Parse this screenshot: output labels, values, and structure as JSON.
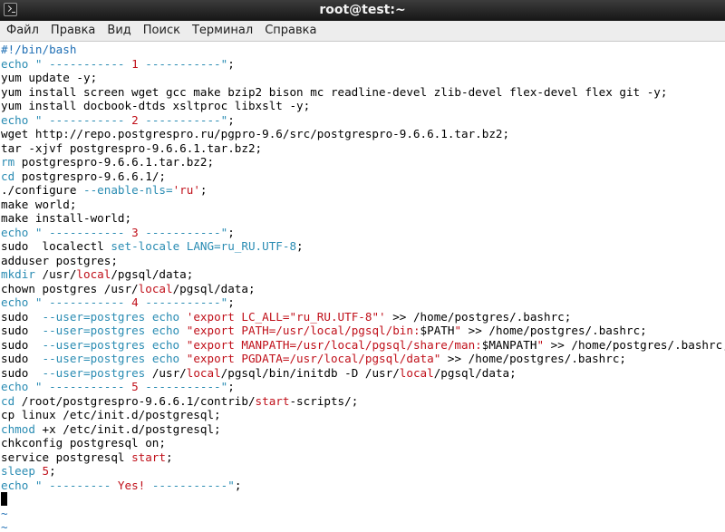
{
  "window": {
    "title": "root@test:~"
  },
  "menu": [
    {
      "label": "Файл"
    },
    {
      "label": "Правка"
    },
    {
      "label": "Вид"
    },
    {
      "label": "Поиск"
    },
    {
      "label": "Терминал"
    },
    {
      "label": "Справка"
    }
  ],
  "terminal": {
    "lines": [
      [
        {
          "t": "#!/bin/bash",
          "c": "t"
        }
      ],
      [
        {
          "t": "echo \" ----------- ",
          "c": "b"
        },
        {
          "t": "1",
          "c": "r"
        },
        {
          "t": " -----------\"",
          "c": "b"
        },
        {
          "t": ";",
          "c": ""
        }
      ],
      [
        {
          "t": "yum update -y;",
          "c": ""
        }
      ],
      [
        {
          "t": "yum install screen wget gcc make bzip2 bison mc readline-devel zlib-devel flex-devel flex git -y;",
          "c": ""
        }
      ],
      [
        {
          "t": "yum install docbook-dtds xsltproc libxslt -y;",
          "c": ""
        }
      ],
      [
        {
          "t": "echo \" ----------- ",
          "c": "b"
        },
        {
          "t": "2",
          "c": "r"
        },
        {
          "t": " -----------\"",
          "c": "b"
        },
        {
          "t": ";",
          "c": ""
        }
      ],
      [
        {
          "t": "wget http://repo.postgrespro.ru/pgpro-9.6/src/postgrespro-9.6.6.1.tar.bz2;",
          "c": ""
        }
      ],
      [
        {
          "t": "tar -xjvf postgrespro-9.6.6.1.tar.bz2;",
          "c": ""
        }
      ],
      [
        {
          "t": "rm",
          "c": "b"
        },
        {
          "t": " postgrespro-9.6.6.1.tar.bz2;",
          "c": ""
        }
      ],
      [
        {
          "t": "cd",
          "c": "b"
        },
        {
          "t": " postgrespro-9.6.6.1/;",
          "c": ""
        }
      ],
      [
        {
          "t": "./configure ",
          "c": ""
        },
        {
          "t": "--enable-nls=",
          "c": "b"
        },
        {
          "t": "'ru'",
          "c": "r"
        },
        {
          "t": ";",
          "c": ""
        }
      ],
      [
        {
          "t": "make world;",
          "c": ""
        }
      ],
      [
        {
          "t": "make install-world;",
          "c": ""
        }
      ],
      [
        {
          "t": "echo \" ----------- ",
          "c": "b"
        },
        {
          "t": "3",
          "c": "r"
        },
        {
          "t": " -----------\"",
          "c": "b"
        },
        {
          "t": ";",
          "c": ""
        }
      ],
      [
        {
          "t": "sudo  localectl ",
          "c": ""
        },
        {
          "t": "set-locale LANG=ru_RU.UTF-8",
          "c": "b"
        },
        {
          "t": ";",
          "c": ""
        }
      ],
      [
        {
          "t": "adduser postgres;",
          "c": ""
        }
      ],
      [
        {
          "t": "mkdir",
          "c": "b"
        },
        {
          "t": " /usr/",
          "c": ""
        },
        {
          "t": "local",
          "c": "r"
        },
        {
          "t": "/pgsql/data;",
          "c": ""
        }
      ],
      [
        {
          "t": "chown postgres /usr/",
          "c": ""
        },
        {
          "t": "local",
          "c": "r"
        },
        {
          "t": "/pgsql/data;",
          "c": ""
        }
      ],
      [
        {
          "t": "echo \" ----------- ",
          "c": "b"
        },
        {
          "t": "4",
          "c": "r"
        },
        {
          "t": " -----------\"",
          "c": "b"
        },
        {
          "t": ";",
          "c": ""
        }
      ],
      [
        {
          "t": "sudo  ",
          "c": ""
        },
        {
          "t": "--user=postgres echo ",
          "c": "b"
        },
        {
          "t": "'export LC_ALL=\"ru_RU.UTF-8\"'",
          "c": "r"
        },
        {
          "t": " >> /home/postgres/.bashrc;",
          "c": ""
        }
      ],
      [
        {
          "t": "sudo  ",
          "c": ""
        },
        {
          "t": "--user=postgres echo ",
          "c": "b"
        },
        {
          "t": "\"export PATH=/usr/local/pgsql/bin:",
          "c": "r"
        },
        {
          "t": "$PATH",
          "c": ""
        },
        {
          "t": "\"",
          "c": "r"
        },
        {
          "t": " >> /home/postgres/.bashrc;",
          "c": ""
        }
      ],
      [
        {
          "t": "sudo  ",
          "c": ""
        },
        {
          "t": "--user=postgres echo ",
          "c": "b"
        },
        {
          "t": "\"export MANPATH=/usr/local/pgsql/share/man:",
          "c": "r"
        },
        {
          "t": "$MANPATH",
          "c": ""
        },
        {
          "t": "\"",
          "c": "r"
        },
        {
          "t": " >> /home/postgres/.bashrc;",
          "c": ""
        }
      ],
      [
        {
          "t": "sudo  ",
          "c": ""
        },
        {
          "t": "--user=postgres echo ",
          "c": "b"
        },
        {
          "t": "\"export PGDATA=/usr/local/pgsql/data\"",
          "c": "r"
        },
        {
          "t": " >> /home/postgres/.bashrc;",
          "c": ""
        }
      ],
      [
        {
          "t": "sudo  ",
          "c": ""
        },
        {
          "t": "--user=postgres",
          "c": "b"
        },
        {
          "t": " /usr/",
          "c": ""
        },
        {
          "t": "local",
          "c": "r"
        },
        {
          "t": "/pgsql/bin/initdb -D /usr/",
          "c": ""
        },
        {
          "t": "local",
          "c": "r"
        },
        {
          "t": "/pgsql/data;",
          "c": ""
        }
      ],
      [
        {
          "t": "echo \" ----------- ",
          "c": "b"
        },
        {
          "t": "5",
          "c": "r"
        },
        {
          "t": " -----------\"",
          "c": "b"
        },
        {
          "t": ";",
          "c": ""
        }
      ],
      [
        {
          "t": "cd",
          "c": "b"
        },
        {
          "t": " /root/postgrespro-9.6.6.1/contrib/",
          "c": ""
        },
        {
          "t": "start",
          "c": "r"
        },
        {
          "t": "-scripts/;",
          "c": ""
        }
      ],
      [
        {
          "t": "cp linux /etc/init.d/postgresql;",
          "c": ""
        }
      ],
      [
        {
          "t": "chmod",
          "c": "b"
        },
        {
          "t": " +x /etc/init.d/postgresql;",
          "c": ""
        }
      ],
      [
        {
          "t": "chkconfig postgresql on;",
          "c": ""
        }
      ],
      [
        {
          "t": "service postgresql ",
          "c": ""
        },
        {
          "t": "start",
          "c": "r"
        },
        {
          "t": ";",
          "c": ""
        }
      ],
      [
        {
          "t": "sleep",
          "c": "b"
        },
        {
          "t": " ",
          "c": ""
        },
        {
          "t": "5",
          "c": "r"
        },
        {
          "t": ";",
          "c": ""
        }
      ],
      [
        {
          "t": "echo \" --------- ",
          "c": "b"
        },
        {
          "t": "Yes!",
          "c": "r"
        },
        {
          "t": " -----------\"",
          "c": "b"
        },
        {
          "t": ";",
          "c": ""
        }
      ],
      [],
      [
        {
          "t": "~",
          "c": "t"
        }
      ],
      [
        {
          "t": "~",
          "c": "t"
        }
      ]
    ],
    "cursor_line": 32
  }
}
